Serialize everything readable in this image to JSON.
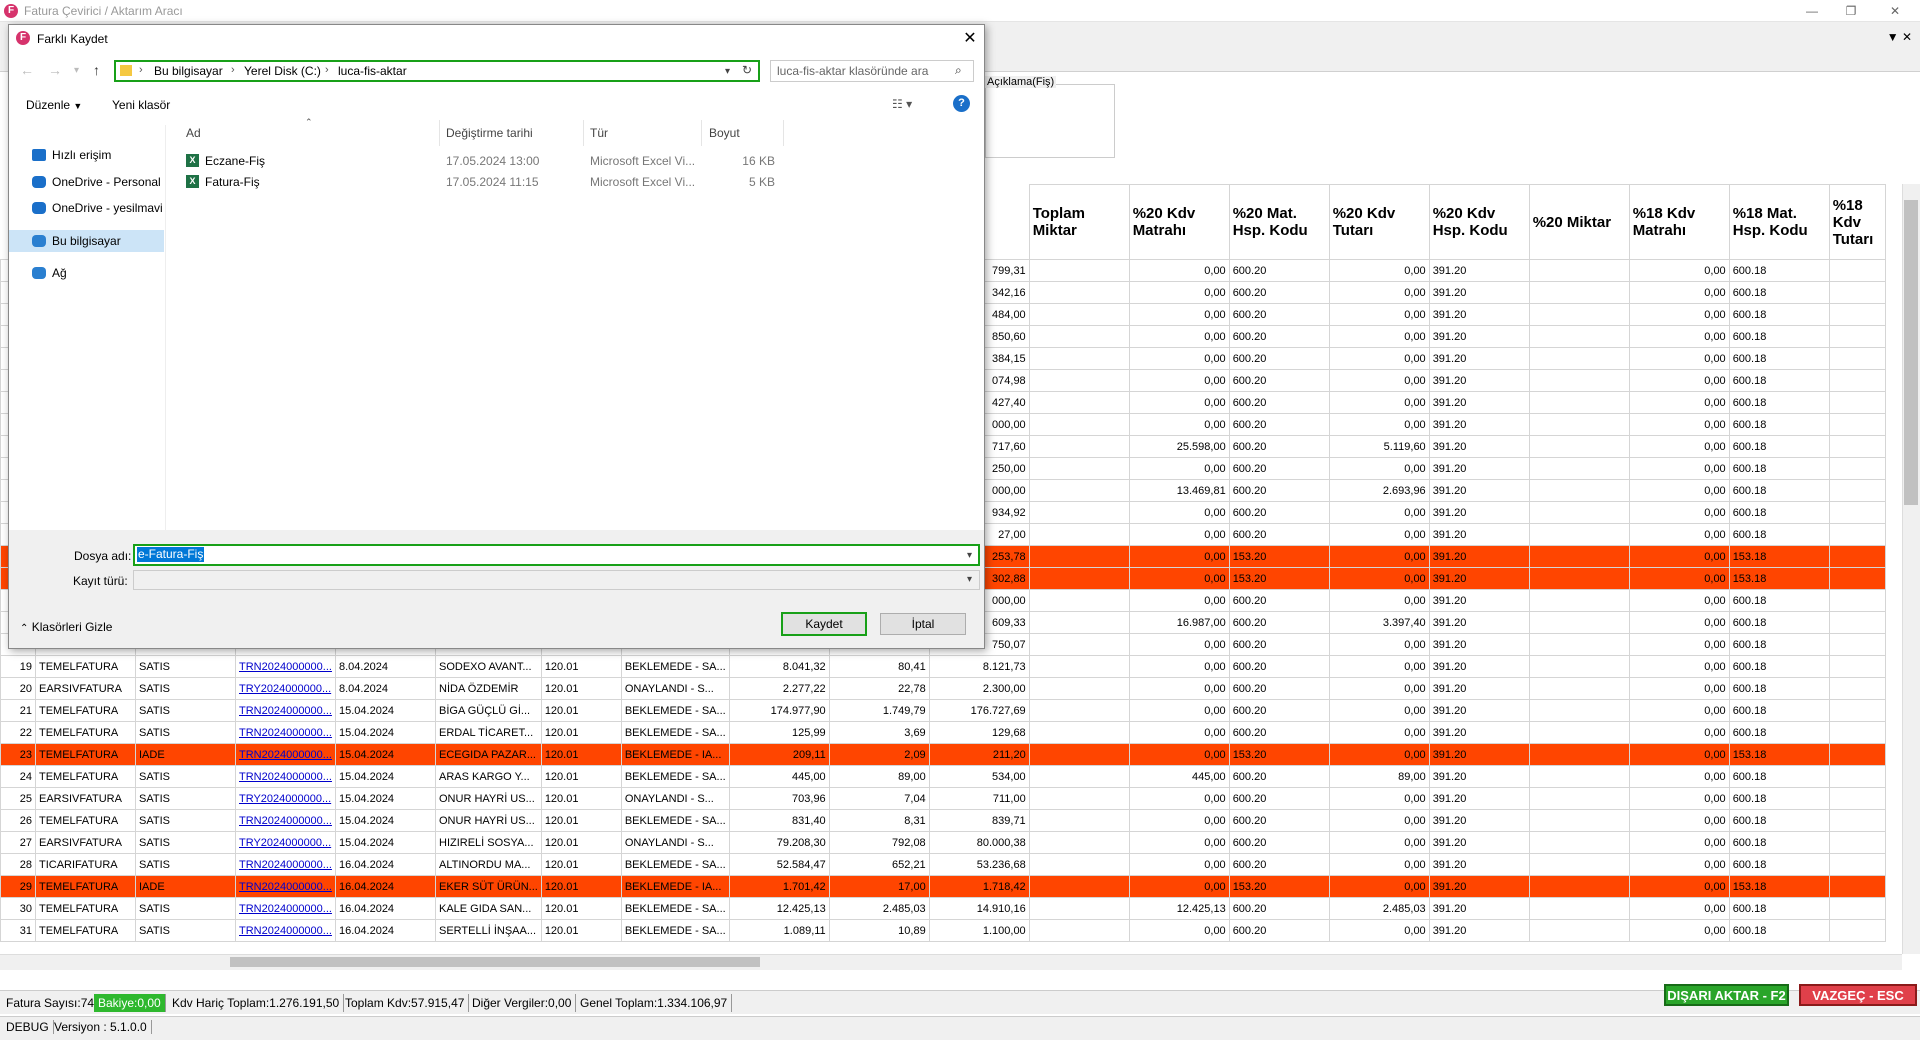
{
  "app": {
    "title": "Fatura Çevirici / Aktarım Aracı",
    "icon_letter": "F",
    "win_min": "—",
    "win_max": "❐",
    "win_close": "✕"
  },
  "background": {
    "description_label": "Açıklama(Fiş)",
    "headers": [
      "Toplam Miktar",
      "%20 Kdv Matrahı",
      "%20 Mat. Hsp. Kodu",
      "%20 Kdv Tutarı",
      "%20 Kdv Hsp. Kodu",
      "%20 Miktar",
      "%18 Kdv Matrahı",
      "%18 Mat. Hsp. Kodu",
      "%18 Kdv Tutarı"
    ],
    "upper_rows": [
      {
        "t": "799,31",
        "m20": "0,00",
        "h20": "600.20",
        "k20": "0,00",
        "kh20": "391.20",
        "m18": "0,00",
        "h18": "600.18",
        "hl": false
      },
      {
        "t": "342,16",
        "m20": "0,00",
        "h20": "600.20",
        "k20": "0,00",
        "kh20": "391.20",
        "m18": "0,00",
        "h18": "600.18",
        "hl": false
      },
      {
        "t": "484,00",
        "m20": "0,00",
        "h20": "600.20",
        "k20": "0,00",
        "kh20": "391.20",
        "m18": "0,00",
        "h18": "600.18",
        "hl": false
      },
      {
        "t": "850,60",
        "m20": "0,00",
        "h20": "600.20",
        "k20": "0,00",
        "kh20": "391.20",
        "m18": "0,00",
        "h18": "600.18",
        "hl": false
      },
      {
        "t": "384,15",
        "m20": "0,00",
        "h20": "600.20",
        "k20": "0,00",
        "kh20": "391.20",
        "m18": "0,00",
        "h18": "600.18",
        "hl": false
      },
      {
        "t": "074,98",
        "m20": "0,00",
        "h20": "600.20",
        "k20": "0,00",
        "kh20": "391.20",
        "m18": "0,00",
        "h18": "600.18",
        "hl": false
      },
      {
        "t": "427,40",
        "m20": "0,00",
        "h20": "600.20",
        "k20": "0,00",
        "kh20": "391.20",
        "m18": "0,00",
        "h18": "600.18",
        "hl": false
      },
      {
        "t": "000,00",
        "m20": "0,00",
        "h20": "600.20",
        "k20": "0,00",
        "kh20": "391.20",
        "m18": "0,00",
        "h18": "600.18",
        "hl": false
      },
      {
        "t": "717,60",
        "m20": "25.598,00",
        "h20": "600.20",
        "k20": "5.119,60",
        "kh20": "391.20",
        "m18": "0,00",
        "h18": "600.18",
        "hl": false
      },
      {
        "t": "250,00",
        "m20": "0,00",
        "h20": "600.20",
        "k20": "0,00",
        "kh20": "391.20",
        "m18": "0,00",
        "h18": "600.18",
        "hl": false
      },
      {
        "t": "000,00",
        "m20": "13.469,81",
        "h20": "600.20",
        "k20": "2.693,96",
        "kh20": "391.20",
        "m18": "0,00",
        "h18": "600.18",
        "hl": false
      },
      {
        "t": "934,92",
        "m20": "0,00",
        "h20": "600.20",
        "k20": "0,00",
        "kh20": "391.20",
        "m18": "0,00",
        "h18": "600.18",
        "hl": false
      },
      {
        "t": "27,00",
        "m20": "0,00",
        "h20": "600.20",
        "k20": "0,00",
        "kh20": "391.20",
        "m18": "0,00",
        "h18": "600.18",
        "hl": false
      },
      {
        "t": "253,78",
        "m20": "0,00",
        "h20": "153.20",
        "k20": "0,00",
        "kh20": "391.20",
        "m18": "0,00",
        "h18": "153.18",
        "hl": true
      },
      {
        "t": "302,88",
        "m20": "0,00",
        "h20": "153.20",
        "k20": "0,00",
        "kh20": "391.20",
        "m18": "0,00",
        "h18": "153.18",
        "hl": true
      },
      {
        "t": "000,00",
        "m20": "0,00",
        "h20": "600.20",
        "k20": "0,00",
        "kh20": "391.20",
        "m18": "0,00",
        "h18": "600.18",
        "hl": false
      },
      {
        "t": "609,33",
        "m20": "16.987,00",
        "h20": "600.20",
        "k20": "3.397,40",
        "kh20": "391.20",
        "m18": "0,00",
        "h18": "600.18",
        "hl": false
      },
      {
        "t": "750,07",
        "m20": "0,00",
        "h20": "600.20",
        "k20": "0,00",
        "kh20": "391.20",
        "m18": "0,00",
        "h18": "600.18",
        "hl": false
      }
    ],
    "lower_rows": [
      {
        "no": "19",
        "tip": "TEMELFATURA",
        "sat": "SATIS",
        "fno": "TRN2024000000...",
        "tar": "8.04.2024",
        "unv": "SODEXO AVANT...",
        "hsp": "120.01",
        "dur": "BEKLEMEDE - SA...",
        "mat": "8.041,32",
        "kdv": "80,41",
        "top": "8.121,73",
        "m20": "0,00",
        "h20": "600.20",
        "k20": "0,00",
        "kh20": "391.20",
        "m18": "0,00",
        "h18": "600.18",
        "hl": false
      },
      {
        "no": "20",
        "tip": "EARSIVFATURA",
        "sat": "SATIS",
        "fno": "TRY2024000000...",
        "tar": "8.04.2024",
        "unv": "NİDA ÖZDEMİR",
        "hsp": "120.01",
        "dur": "ONAYLANDI - S...",
        "mat": "2.277,22",
        "kdv": "22,78",
        "top": "2.300,00",
        "m20": "0,00",
        "h20": "600.20",
        "k20": "0,00",
        "kh20": "391.20",
        "m18": "0,00",
        "h18": "600.18",
        "hl": false
      },
      {
        "no": "21",
        "tip": "TEMELFATURA",
        "sat": "SATIS",
        "fno": "TRN2024000000...",
        "tar": "15.04.2024",
        "unv": "BİGA GÜÇLÜ Gİ...",
        "hsp": "120.01",
        "dur": "BEKLEMEDE - SA...",
        "mat": "174.977,90",
        "kdv": "1.749,79",
        "top": "176.727,69",
        "m20": "0,00",
        "h20": "600.20",
        "k20": "0,00",
        "kh20": "391.20",
        "m18": "0,00",
        "h18": "600.18",
        "hl": false
      },
      {
        "no": "22",
        "tip": "TEMELFATURA",
        "sat": "SATIS",
        "fno": "TRN2024000000...",
        "tar": "15.04.2024",
        "unv": "ERDAL TİCARET...",
        "hsp": "120.01",
        "dur": "BEKLEMEDE - SA...",
        "mat": "125,99",
        "kdv": "3,69",
        "top": "129,68",
        "m20": "0,00",
        "h20": "600.20",
        "k20": "0,00",
        "kh20": "391.20",
        "m18": "0,00",
        "h18": "600.18",
        "hl": false
      },
      {
        "no": "23",
        "tip": "TEMELFATURA",
        "sat": "IADE",
        "fno": "TRN2024000000...",
        "tar": "15.04.2024",
        "unv": "ECEGIDA PAZAR...",
        "hsp": "120.01",
        "dur": "BEKLEMEDE - IA...",
        "mat": "209,11",
        "kdv": "2,09",
        "top": "211,20",
        "m20": "0,00",
        "h20": "153.20",
        "k20": "0,00",
        "kh20": "391.20",
        "m18": "0,00",
        "h18": "153.18",
        "hl": true
      },
      {
        "no": "24",
        "tip": "TEMELFATURA",
        "sat": "SATIS",
        "fno": "TRN2024000000...",
        "tar": "15.04.2024",
        "unv": "ARAS KARGO Y...",
        "hsp": "120.01",
        "dur": "BEKLEMEDE - SA...",
        "mat": "445,00",
        "kdv": "89,00",
        "top": "534,00",
        "m20": "445,00",
        "h20": "600.20",
        "k20": "89,00",
        "kh20": "391.20",
        "m18": "0,00",
        "h18": "600.18",
        "hl": false
      },
      {
        "no": "25",
        "tip": "EARSIVFATURA",
        "sat": "SATIS",
        "fno": "TRY2024000000...",
        "tar": "15.04.2024",
        "unv": "ONUR HAYRİ US...",
        "hsp": "120.01",
        "dur": "ONAYLANDI - S...",
        "mat": "703,96",
        "kdv": "7,04",
        "top": "711,00",
        "m20": "0,00",
        "h20": "600.20",
        "k20": "0,00",
        "kh20": "391.20",
        "m18": "0,00",
        "h18": "600.18",
        "hl": false
      },
      {
        "no": "26",
        "tip": "TEMELFATURA",
        "sat": "SATIS",
        "fno": "TRN2024000000...",
        "tar": "15.04.2024",
        "unv": "ONUR HAYRİ US...",
        "hsp": "120.01",
        "dur": "BEKLEMEDE - SA...",
        "mat": "831,40",
        "kdv": "8,31",
        "top": "839,71",
        "m20": "0,00",
        "h20": "600.20",
        "k20": "0,00",
        "kh20": "391.20",
        "m18": "0,00",
        "h18": "600.18",
        "hl": false
      },
      {
        "no": "27",
        "tip": "EARSIVFATURA",
        "sat": "SATIS",
        "fno": "TRY2024000000...",
        "tar": "15.04.2024",
        "unv": "HIZIRELİ SOSYA...",
        "hsp": "120.01",
        "dur": "ONAYLANDI - S...",
        "mat": "79.208,30",
        "kdv": "792,08",
        "top": "80.000,38",
        "m20": "0,00",
        "h20": "600.20",
        "k20": "0,00",
        "kh20": "391.20",
        "m18": "0,00",
        "h18": "600.18",
        "hl": false
      },
      {
        "no": "28",
        "tip": "TICARIFATURA",
        "sat": "SATIS",
        "fno": "TRN2024000000...",
        "tar": "16.04.2024",
        "unv": "ALTINORDU MA...",
        "hsp": "120.01",
        "dur": "BEKLEMEDE - SA...",
        "mat": "52.584,47",
        "kdv": "652,21",
        "top": "53.236,68",
        "m20": "0,00",
        "h20": "600.20",
        "k20": "0,00",
        "kh20": "391.20",
        "m18": "0,00",
        "h18": "600.18",
        "hl": false
      },
      {
        "no": "29",
        "tip": "TEMELFATURA",
        "sat": "IADE",
        "fno": "TRN2024000000...",
        "tar": "16.04.2024",
        "unv": "EKER SÜT ÜRÜN...",
        "hsp": "120.01",
        "dur": "BEKLEMEDE - IA...",
        "mat": "1.701,42",
        "kdv": "17,00",
        "top": "1.718,42",
        "m20": "0,00",
        "h20": "153.20",
        "k20": "0,00",
        "kh20": "391.20",
        "m18": "0,00",
        "h18": "153.18",
        "hl": true
      },
      {
        "no": "30",
        "tip": "TEMELFATURA",
        "sat": "SATIS",
        "fno": "TRN2024000000...",
        "tar": "16.04.2024",
        "unv": "KALE GIDA SAN...",
        "hsp": "120.01",
        "dur": "BEKLEMEDE - SA...",
        "mat": "12.425,13",
        "kdv": "2.485,03",
        "top": "14.910,16",
        "m20": "12.425,13",
        "h20": "600.20",
        "k20": "2.485,03",
        "kh20": "391.20",
        "m18": "0,00",
        "h18": "600.18",
        "hl": false
      },
      {
        "no": "31",
        "tip": "TEMELFATURA",
        "sat": "SATIS",
        "fno": "TRN2024000000...",
        "tar": "16.04.2024",
        "unv": "SERTELLİ İNŞAA...",
        "hsp": "120.01",
        "dur": "BEKLEMEDE - SA...",
        "mat": "1.089,11",
        "kdv": "10,89",
        "top": "1.100,00",
        "m20": "0,00",
        "h20": "600.20",
        "k20": "0,00",
        "kh20": "391.20",
        "m18": "0,00",
        "h18": "600.18",
        "hl": false
      }
    ]
  },
  "statusbar": {
    "fatura_sayisi": "Fatura Sayısı:74",
    "bakiye": "Bakiye:0,00",
    "kdv_haric": "Kdv Hariç Toplam:1.276.191,50",
    "toplam_kdv": "Toplam Kdv:57.915,47",
    "diger": "Diğer Vergiler:0,00",
    "genel": "Genel Toplam:1.334.106,97",
    "export_button": "DIŞARI AKTAR - F2",
    "cancel_button": "VAZGEÇ - ESC",
    "debug": "DEBUG",
    "version": "Versiyon : 5.1.0.0"
  },
  "dialog": {
    "title": "Farklı Kaydet",
    "close": "✕",
    "breadcrumb": [
      "Bu bilgisayar",
      "Yerel Disk (C:)",
      "luca-fis-aktar"
    ],
    "search_placeholder": "luca-fis-aktar klasöründe ara",
    "organize": "Düzenle",
    "new_folder": "Yeni klasör",
    "help": "?",
    "nav": [
      {
        "label": "Hızlı erişim",
        "icon": "star-icon"
      },
      {
        "label": "OneDrive - Personal",
        "icon": "onedrive-error-icon"
      },
      {
        "label": "OneDrive - yesilmavi",
        "icon": "onedrive-icon"
      },
      {
        "label": "Bu bilgisayar",
        "icon": "computer-icon"
      },
      {
        "label": "Ağ",
        "icon": "network-icon"
      }
    ],
    "columns": {
      "name": "Ad",
      "modified": "Değiştirme tarihi",
      "type": "Tür",
      "size": "Boyut"
    },
    "files": [
      {
        "name": "Eczane-Fiş",
        "modified": "17.05.2024 13:00",
        "type": "Microsoft Excel Vi...",
        "size": "16 KB"
      },
      {
        "name": "Fatura-Fiş",
        "modified": "17.05.2024 11:15",
        "type": "Microsoft Excel Vi...",
        "size": "5 KB"
      }
    ],
    "file_name_label": "Dosya adı:",
    "file_name_value": "e-Fatura-Fiş",
    "file_type_label": "Kayıt türü:",
    "save_button": "Kaydet",
    "cancel_button": "İptal",
    "hide_folders": "Klasörleri Gizle"
  }
}
